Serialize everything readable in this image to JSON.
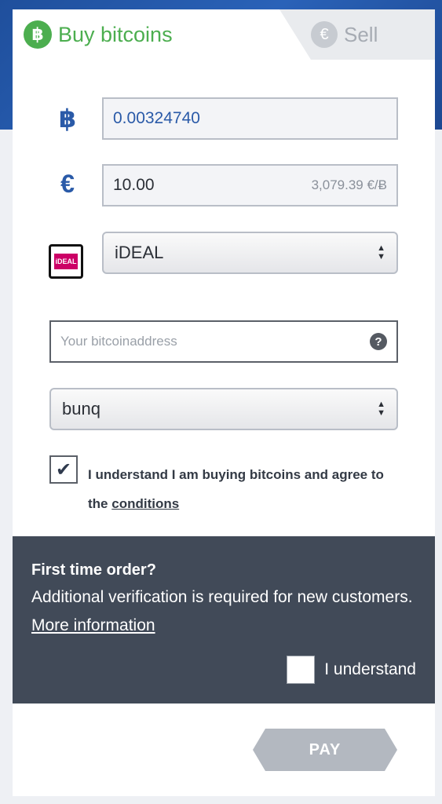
{
  "tabs": {
    "buy": {
      "label": "Buy bitcoins",
      "icon": "bitcoin-icon",
      "icon_glyph": "฿",
      "color": "#4cae4f"
    },
    "sell": {
      "label": "Sell",
      "icon": "euro-icon",
      "icon_glyph": "€"
    }
  },
  "bitcoin_row": {
    "icon_glyph": "฿",
    "value": "0.00324740"
  },
  "euro_row": {
    "icon_glyph": "€",
    "value": "10.00",
    "rate": "3,079.39 €/Ƀ"
  },
  "payment_method": {
    "icon": "ideal-logo",
    "logo_text": "iDEAL",
    "selected": "iDEAL"
  },
  "address": {
    "placeholder": "Your bitcoinaddress",
    "help_glyph": "?"
  },
  "bank": {
    "selected": "bunq"
  },
  "agreement": {
    "checked": true,
    "check_glyph": "✔",
    "text": "I understand I am buying bitcoins and agree to the ",
    "link": "conditions"
  },
  "notice": {
    "title": "First time order?",
    "body": "Additional verification is required for new customers. ",
    "link": "More information",
    "confirm_label": "I understand"
  },
  "pay_button": {
    "label": "PAY"
  },
  "colors": {
    "accent_green": "#4cae4f",
    "accent_blue": "#2a5aa8",
    "notice_bg": "#414a58",
    "pay_bg": "#b3b8c0"
  }
}
